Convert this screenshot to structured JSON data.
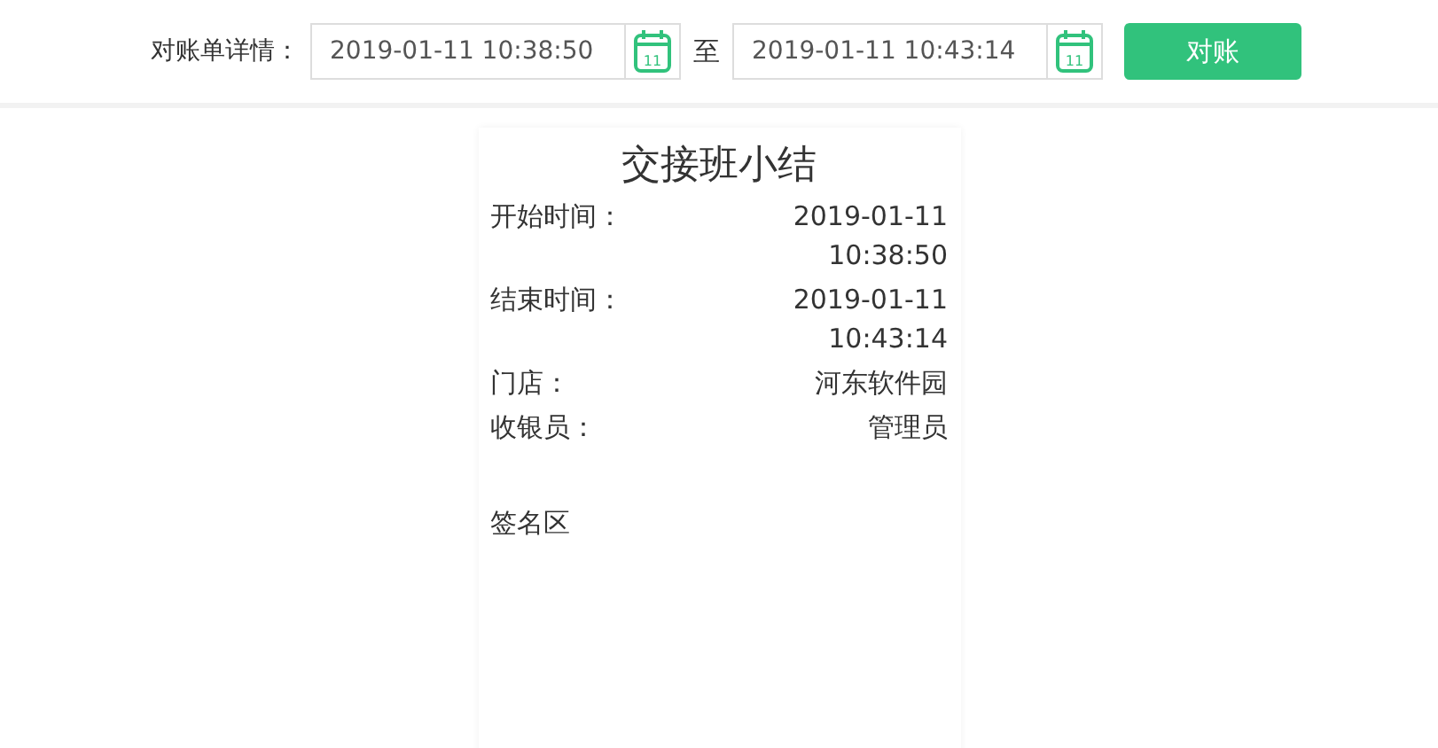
{
  "toolbar": {
    "label": "对账单详情：",
    "start": {
      "value": "2019-01-11 10:38:50",
      "calendar_day": "11"
    },
    "separator": "至",
    "end": {
      "value": "2019-01-11 10:43:14",
      "calendar_day": "11"
    },
    "button": "对账"
  },
  "summary": {
    "title": "交接班小结",
    "rows": [
      {
        "label": "开始时间：",
        "value": "2019-01-11 10:38:50"
      },
      {
        "label": "结束时间：",
        "value": "2019-01-11 10:43:14"
      },
      {
        "label": "门店：",
        "value": "河东软件园"
      },
      {
        "label": "收银员：",
        "value": "管理员"
      }
    ],
    "signature": "签名区"
  }
}
